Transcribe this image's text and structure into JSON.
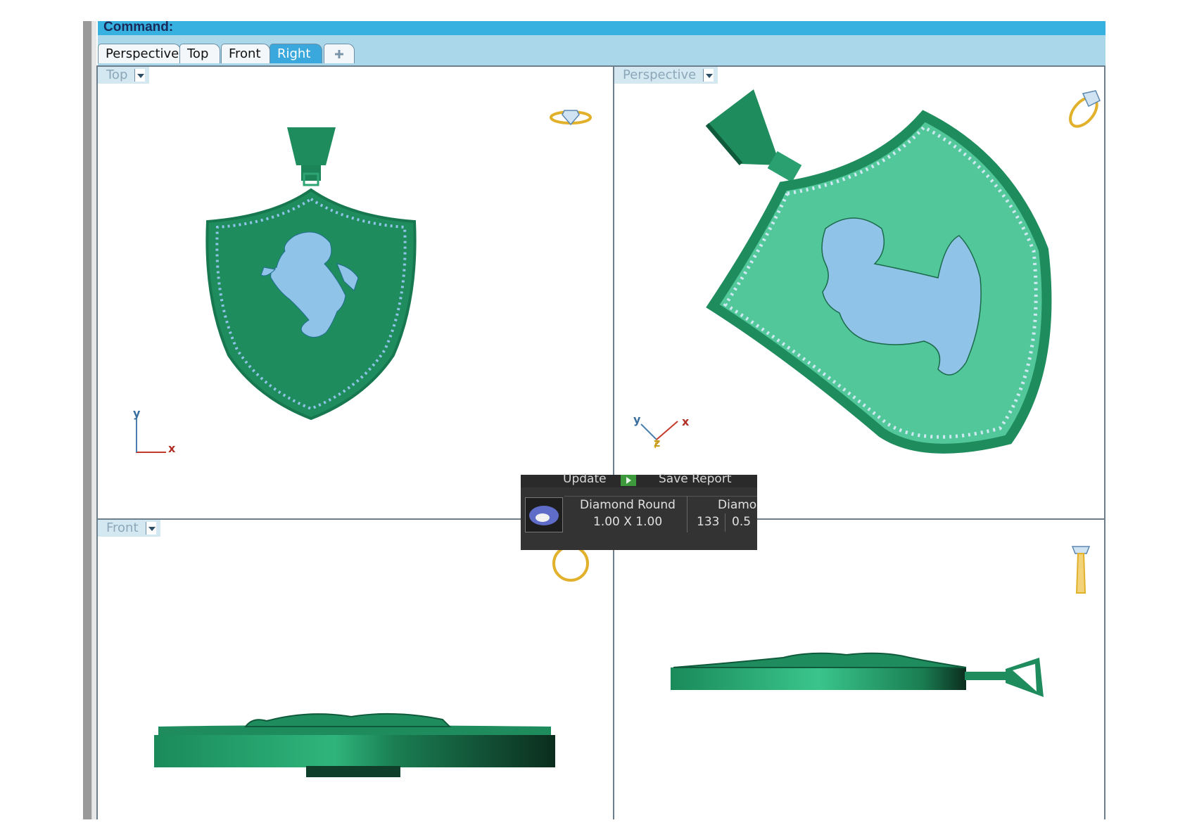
{
  "command": {
    "label": "Command:"
  },
  "tabs": [
    {
      "label": "Perspective",
      "active": false
    },
    {
      "label": "Top",
      "active": false
    },
    {
      "label": "Front",
      "active": false
    },
    {
      "label": "Right",
      "active": true
    }
  ],
  "tab_add_icon": "plus-icon",
  "viewports": {
    "top": {
      "label": "Top"
    },
    "perspective": {
      "label": "Perspective"
    },
    "front": {
      "label": "Front"
    }
  },
  "axes": {
    "x": "x",
    "y": "y",
    "z": "z"
  },
  "report": {
    "update_label": "Update",
    "save_label": "Save Report",
    "row": {
      "name": "Diamond Round",
      "size": "1.00 X 1.00",
      "count": "133",
      "partial_name": "Diamo",
      "partial_value": "0.5"
    }
  },
  "colors": {
    "model_green": "#1f8c5e",
    "model_light_green": "#52c89a",
    "gem_blue": "#8fc3e8",
    "command_bar": "#37b2e0",
    "tab_bar": "#aad8ea",
    "active_tab": "#3aa8dd"
  }
}
